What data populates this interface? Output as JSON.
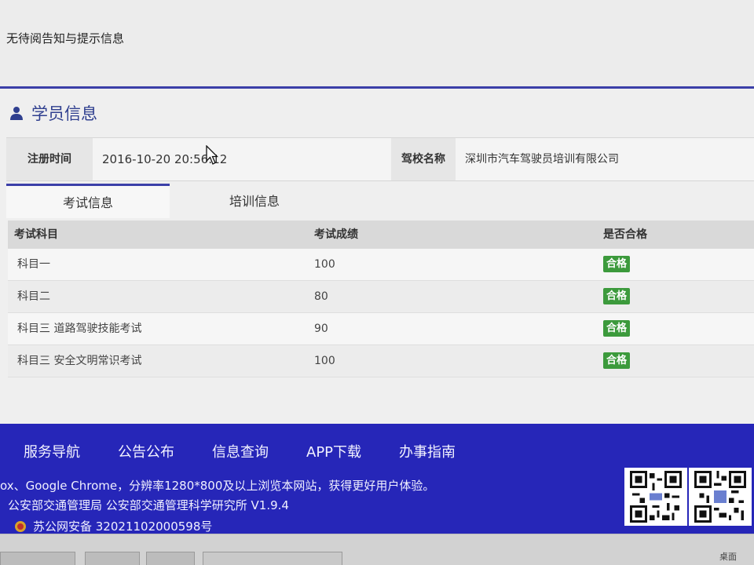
{
  "notice": {
    "text": "无待阅告知与提示信息"
  },
  "panel": {
    "title": "学员信息",
    "title_icon": "user-icon"
  },
  "info": {
    "reg_time_label": "注册时间",
    "reg_time_value": "2016-10-20 20:56:12",
    "school_label": "驾校名称",
    "school_value": "深圳市汽车驾驶员培训有限公司"
  },
  "tabs": [
    {
      "label": "考试信息",
      "active": true
    },
    {
      "label": "培训信息",
      "active": false
    }
  ],
  "exam_table": {
    "headers": [
      "考试科目",
      "考试成绩",
      "是否合格"
    ],
    "rows": [
      {
        "subject": "科目一",
        "score": "100",
        "status": "合格"
      },
      {
        "subject": "科目二",
        "score": "80",
        "status": "合格"
      },
      {
        "subject": "科目三 道路驾驶技能考试",
        "score": "90",
        "status": "合格"
      },
      {
        "subject": "科目三 安全文明常识考试",
        "score": "100",
        "status": "合格"
      }
    ]
  },
  "footer": {
    "nav": [
      "服务导航",
      "公告公布",
      "信息查询",
      "APP下载",
      "办事指南"
    ],
    "browser_note": "ox、Google Chrome，分辨率1280*800及以上浏览本网站，获得更好用户体验。",
    "copyright": "公安部交通管理局 公安部交通管理科学研究所 V1.9.4",
    "icp": "苏公网安备 32021102000598号"
  },
  "taskbar": {
    "desktop_label": "桌面"
  },
  "colors": {
    "accent": "#3b3fa8",
    "footer_bg": "#2626b8",
    "pass_badge": "#3c9a3c"
  }
}
